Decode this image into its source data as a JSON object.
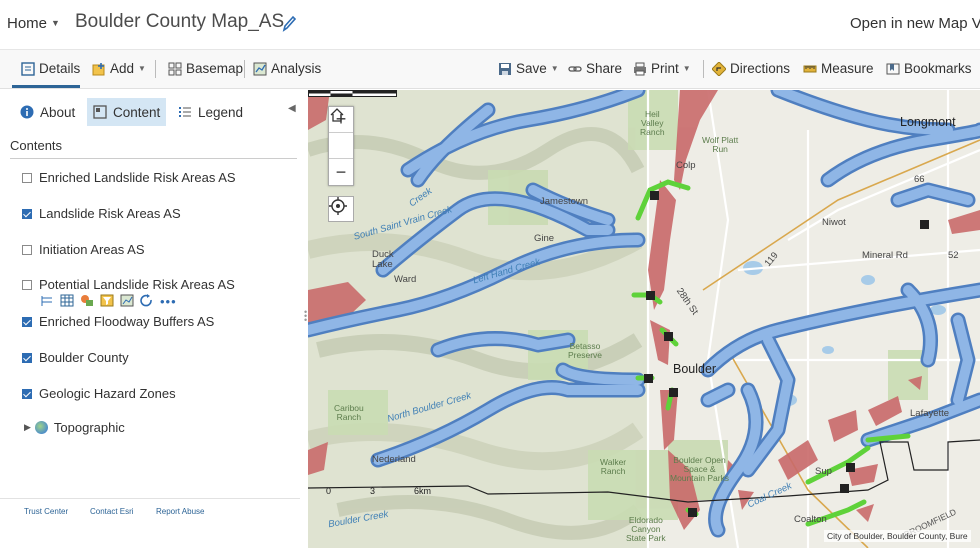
{
  "header": {
    "home_label": "Home",
    "map_title": "Boulder County Map_AS",
    "open_new": "Open in new Map Vi"
  },
  "toolbar": {
    "details": "Details",
    "add": "Add",
    "basemap": "Basemap",
    "analysis": "Analysis",
    "save": "Save",
    "share": "Share",
    "print": "Print",
    "directions": "Directions",
    "measure": "Measure",
    "bookmarks": "Bookmarks"
  },
  "panel": {
    "tabs": {
      "about": "About",
      "content": "Content",
      "legend": "Legend"
    },
    "contents_heading": "Contents",
    "layers": [
      {
        "label": "Enriched Landslide Risk Areas AS",
        "checked": false
      },
      {
        "label": "Landslide Risk Areas AS",
        "checked": true
      },
      {
        "label": "Initiation Areas AS",
        "checked": false
      },
      {
        "label": "Potential Landslide Risk Areas AS",
        "checked": false
      },
      {
        "label": "Enriched Floodway Buffers AS",
        "checked": true
      },
      {
        "label": "Boulder County",
        "checked": true
      },
      {
        "label": "Geologic Hazard Zones",
        "checked": true
      }
    ],
    "basemap_layer": "Topographic",
    "footer": {
      "trust": "Trust Center",
      "contact": "Contact Esri",
      "abuse": "Report Abuse"
    }
  },
  "map": {
    "places": {
      "longmont": "Longmont",
      "jamestown": "Jamestown",
      "ward": "Ward",
      "boulder": "Boulder",
      "nederland": "Nederland",
      "niwot": "Niwot",
      "lafayette": "Lafayette",
      "mineral_rd": "Mineral Rd",
      "colp": "Colp",
      "gine": "Gine",
      "duck_lake": "Duck\nLake",
      "sup": "Sup",
      "coalton": "Coalton",
      "broomfield": "BROOMFIELD"
    },
    "green_labels": {
      "heil": "Heil\nValley\nRanch",
      "wolf": "Wolf Platt\nRun",
      "betasso": "Betasso\nPreserve",
      "caribou": "Caribou\nRanch",
      "walker": "Walker\nRanch",
      "boulder_open": "Boulder Open\nSpace &\nMountain Parks",
      "eldorado": "Eldorado\nCanyon\nState Park"
    },
    "water_labels": {
      "south_saint_vrain": "South Saint Vrain Creek",
      "left_hand": "Left Hand Creek",
      "north_boulder": "North Boulder Creek",
      "boulder_creek": "Boulder Creek",
      "coal_creek": "Coal Creek",
      "creek_top": "Creek"
    },
    "road_labels": {
      "r119": "119",
      "r28th": "28th St",
      "r52": "52",
      "r66": "66"
    },
    "scale": {
      "zero": "0",
      "three": "3",
      "six": "6km"
    },
    "attribution": "City of Boulder, Boulder County, Bure",
    "colors": {
      "buffer_fill": "#7fa8dc",
      "buffer_stroke": "#4f7fc0",
      "hazard_fill": "#c96a6a",
      "landslide_green": "#5fd23a",
      "accent": "#2d6496"
    }
  }
}
